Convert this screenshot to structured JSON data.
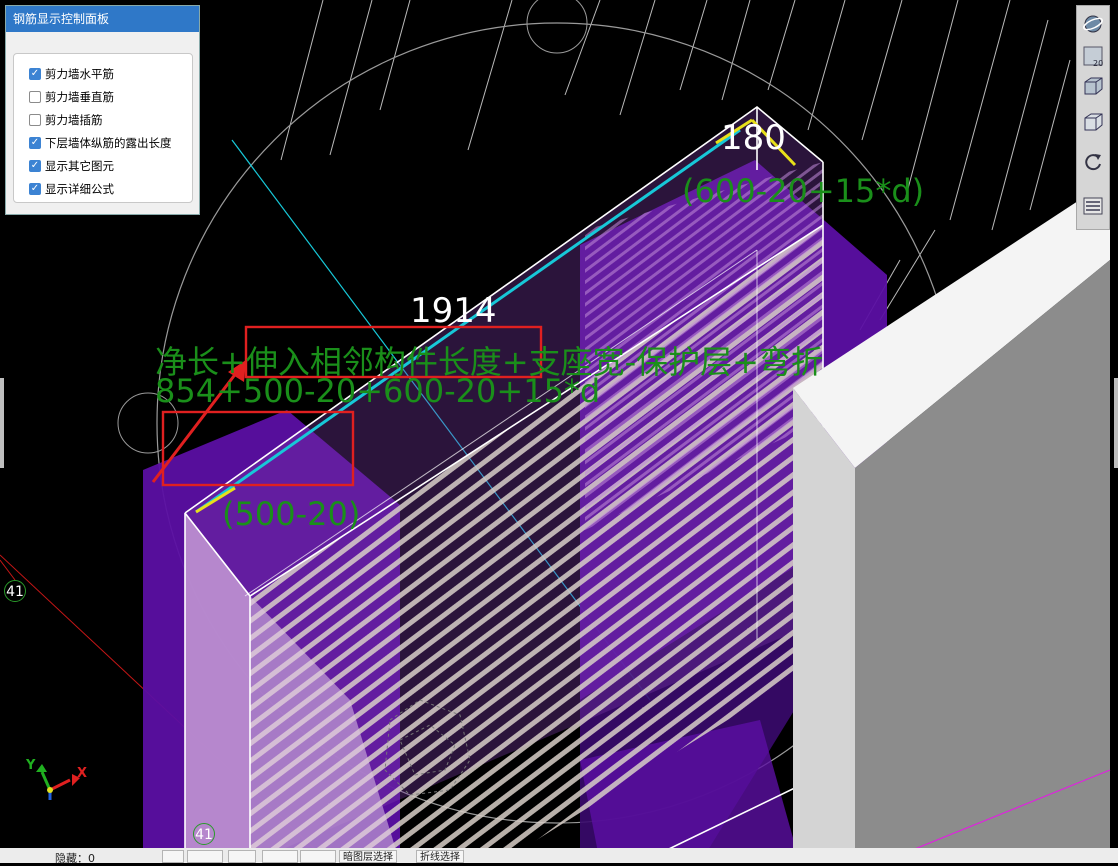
{
  "panel": {
    "title": "钢筋显示控制面板",
    "checkboxes": [
      {
        "label": "剪力墙水平筋",
        "checked": true
      },
      {
        "label": "剪力墙垂直筋",
        "checked": false
      },
      {
        "label": "剪力墙插筋",
        "checked": false
      },
      {
        "label": "下层墙体纵筋的露出长度",
        "checked": true
      },
      {
        "label": "显示其它图元",
        "checked": true
      },
      {
        "label": "显示详细公式",
        "checked": true
      }
    ]
  },
  "viewport": {
    "dim_top": "180",
    "formula_top": "(600-20+15*d)",
    "dim_mid": "1914",
    "formula_line1": "净长+伸入相邻构件长度+支座宽-保护层+弯折",
    "formula_line2": "854+500-20+600-20+15*d",
    "formula_left": "(500-20)",
    "axis_badge_left": "41",
    "axis_badge_bottom": "41",
    "axis_x_label": "X",
    "axis_y_label": "Y"
  },
  "toolbar": {
    "icons": [
      "orbit-icon",
      "top-view-icon",
      "iso-box-icon",
      "box-icon",
      "rotate-icon",
      "layer-panel-icon"
    ],
    "view_badge": "20"
  },
  "bottom_bar": {
    "hidden_label": "隐藏：0",
    "btn_dark_select": "暗图层选择",
    "btn_polyline_select": "折线选择"
  },
  "colors": {
    "panel_title_bg": "#2f78c8",
    "checkbox_on": "#3c83d3",
    "formula_green": "#1a8f1a",
    "highlight_red": "#e02020",
    "purple": "#5a1aa8"
  }
}
